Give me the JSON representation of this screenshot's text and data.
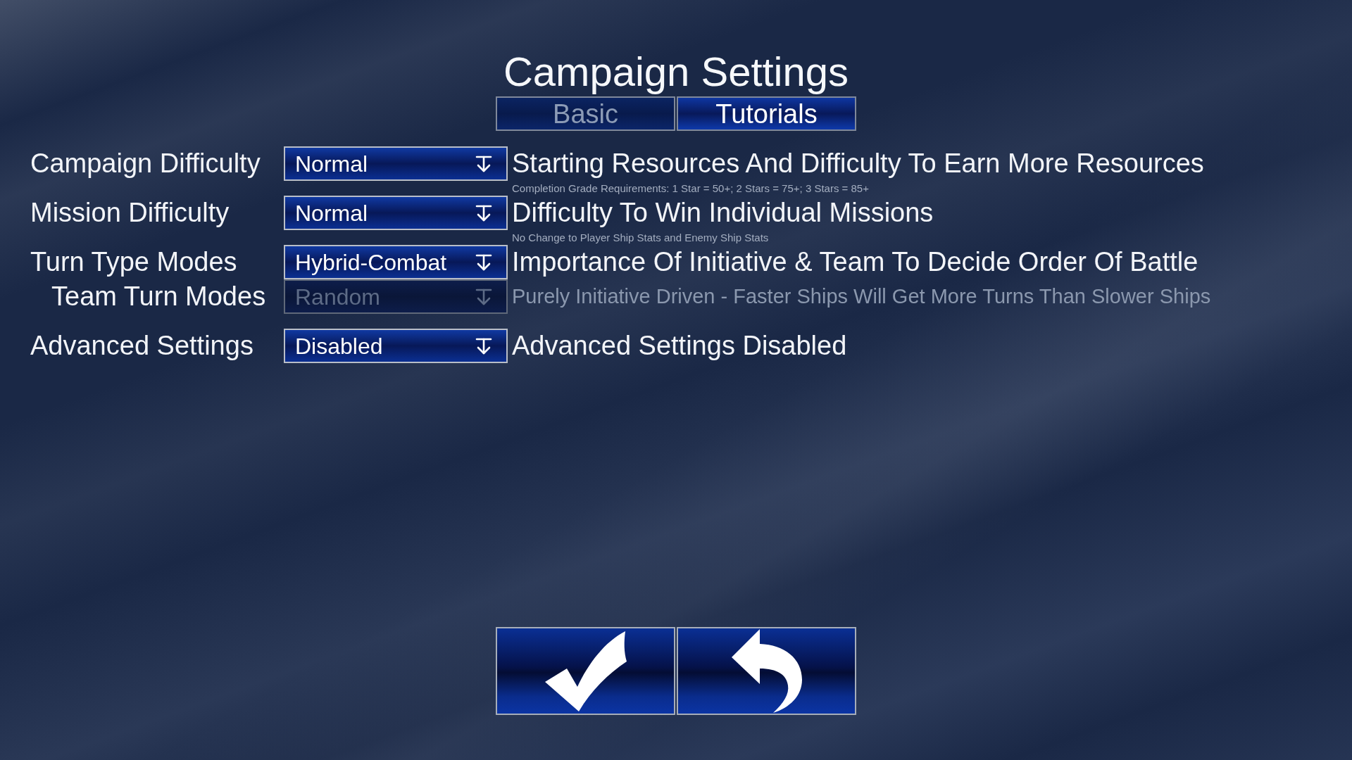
{
  "title": "Campaign Settings",
  "tabs": [
    {
      "label": "Basic",
      "selected": false
    },
    {
      "label": "Tutorials",
      "selected": true
    }
  ],
  "settings": [
    {
      "label": "Campaign Difficulty",
      "value": "Normal",
      "disabled": false,
      "description": "Starting Resources And Difficulty To Earn More Resources",
      "note": "Completion Grade Requirements: 1 Star = 50+; 2 Stars = 75+; 3 Stars = 85+"
    },
    {
      "label": "Mission Difficulty",
      "value": "Normal",
      "disabled": false,
      "description": "Difficulty To Win Individual Missions",
      "note": "No Change to Player Ship Stats and Enemy Ship Stats"
    },
    {
      "label": "Turn Type Modes",
      "value": "Hybrid-Combat",
      "disabled": false,
      "description": "Importance Of Initiative & Team To Decide Order Of Battle",
      "children": [
        {
          "label": "Team Turn Modes",
          "value": "Random",
          "disabled": true,
          "description": "Purely Initiative Driven - Faster Ships Will Get More Turns Than Slower Ships"
        }
      ]
    },
    {
      "label": "Advanced Settings",
      "value": "Disabled",
      "disabled": false,
      "description": "Advanced Settings Disabled"
    }
  ],
  "buttons": [
    {
      "kind": "confirm"
    },
    {
      "kind": "back"
    }
  ]
}
